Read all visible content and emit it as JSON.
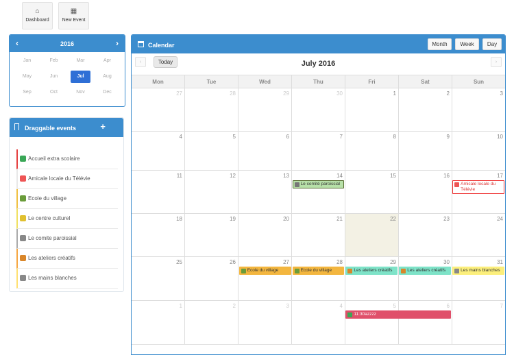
{
  "toolbar": {
    "dashboard": {
      "icon": "⌂",
      "label": "Dashboard"
    },
    "new_event": {
      "icon": "▦",
      "label": "New Event"
    }
  },
  "month_picker": {
    "year": "2016",
    "prev": "‹",
    "next": "›",
    "months": [
      "Jan",
      "Feb",
      "Mar",
      "Apr",
      "May",
      "Jun",
      "Jul",
      "Aug",
      "Sep",
      "Oct",
      "Nov",
      "Dec"
    ],
    "selected_index": 6
  },
  "draggable": {
    "title": "Draggable events",
    "add": "+",
    "items": [
      {
        "label": "Accueil extra scolaire",
        "color": "#e53e3e",
        "icon_color": "#3aa757"
      },
      {
        "label": "Amicale locale du Télévie",
        "color": "#ffffff",
        "icon_color": "#e55"
      },
      {
        "label": "Ecole du village",
        "color": "#f0c040",
        "icon_color": "#6a9c3a"
      },
      {
        "label": "Le centre culturel",
        "color": "#f0e060",
        "icon_color": "#e0c030"
      },
      {
        "label": "Le comite paroissial",
        "color": "#aaa",
        "icon_color": "#888"
      },
      {
        "label": "Les ateliers créatifs",
        "color": "#f6a640",
        "icon_color": "#d9862a"
      },
      {
        "label": "Les mains blanches",
        "color": "#ffe070",
        "icon_color": "#888"
      }
    ]
  },
  "calendar": {
    "title": "Calendar",
    "views": {
      "month": "Month",
      "week": "Week",
      "day": "Day"
    },
    "today": "Today",
    "prev": "‹",
    "next": "›",
    "month_title": "July 2016",
    "dow": [
      "Mon",
      "Tue",
      "Wed",
      "Thu",
      "Fri",
      "Sat",
      "Sun"
    ],
    "weeks": [
      [
        {
          "n": "27",
          "o": true
        },
        {
          "n": "28",
          "o": true
        },
        {
          "n": "29",
          "o": true
        },
        {
          "n": "30",
          "o": true
        },
        {
          "n": "1"
        },
        {
          "n": "2"
        },
        {
          "n": "3"
        }
      ],
      [
        {
          "n": "4"
        },
        {
          "n": "5"
        },
        {
          "n": "6"
        },
        {
          "n": "7"
        },
        {
          "n": "8"
        },
        {
          "n": "9"
        },
        {
          "n": "10"
        }
      ],
      [
        {
          "n": "11"
        },
        {
          "n": "12"
        },
        {
          "n": "13"
        },
        {
          "n": "14"
        },
        {
          "n": "15"
        },
        {
          "n": "16"
        },
        {
          "n": "17"
        }
      ],
      [
        {
          "n": "18"
        },
        {
          "n": "19"
        },
        {
          "n": "20"
        },
        {
          "n": "21"
        },
        {
          "n": "22",
          "t": true
        },
        {
          "n": "23"
        },
        {
          "n": "24"
        }
      ],
      [
        {
          "n": "25"
        },
        {
          "n": "26"
        },
        {
          "n": "27"
        },
        {
          "n": "28"
        },
        {
          "n": "29"
        },
        {
          "n": "30"
        },
        {
          "n": "31"
        }
      ],
      [
        {
          "n": "1",
          "o": true
        },
        {
          "n": "2",
          "o": true
        },
        {
          "n": "3",
          "o": true
        },
        {
          "n": "4",
          "o": true
        },
        {
          "n": "5",
          "o": true
        },
        {
          "n": "6",
          "o": true
        },
        {
          "n": "7",
          "o": true
        }
      ]
    ],
    "events": [
      {
        "week": 2,
        "col": 3,
        "span": 1,
        "label": "Le comité paroissial",
        "bg": "#b7e0a8",
        "fg": "#333",
        "border": "#556b2f",
        "icon": "#777"
      },
      {
        "week": 2,
        "col": 6,
        "span": 1,
        "label": "Amicale locale du Télévie",
        "bg": "#ffffff",
        "fg": "#d33",
        "border": "#e33",
        "icon": "#e55"
      },
      {
        "week": 4,
        "col": 2,
        "span": 1,
        "label": "Ecole du village",
        "bg": "#f3b63f",
        "fg": "#333",
        "border": "#f3b63f",
        "icon": "#6a9c3a"
      },
      {
        "week": 4,
        "col": 3,
        "span": 1,
        "label": "Ecole du village",
        "bg": "#f3b63f",
        "fg": "#333",
        "border": "#f3b63f",
        "icon": "#6a9c3a"
      },
      {
        "week": 4,
        "col": 4,
        "span": 1,
        "label": "Les ateliers créatifs",
        "bg": "#7ee3c8",
        "fg": "#333",
        "border": "#7ee3c8",
        "icon": "#d9862a"
      },
      {
        "week": 4,
        "col": 5,
        "span": 1,
        "label": "Les ateliers créatifs",
        "bg": "#7ee3c8",
        "fg": "#333",
        "border": "#7ee3c8",
        "icon": "#d9862a"
      },
      {
        "week": 4,
        "col": 6,
        "span": 1,
        "label": "Les mains blanches",
        "bg": "#fcef7c",
        "fg": "#333",
        "border": "#fcef7c",
        "icon": "#888"
      },
      {
        "week": 5,
        "col": 4,
        "span": 2,
        "label": "11:30azzzz",
        "bg": "#e0506a",
        "fg": "#fff",
        "border": "#e0506a",
        "icon": "#3aa757"
      }
    ]
  }
}
